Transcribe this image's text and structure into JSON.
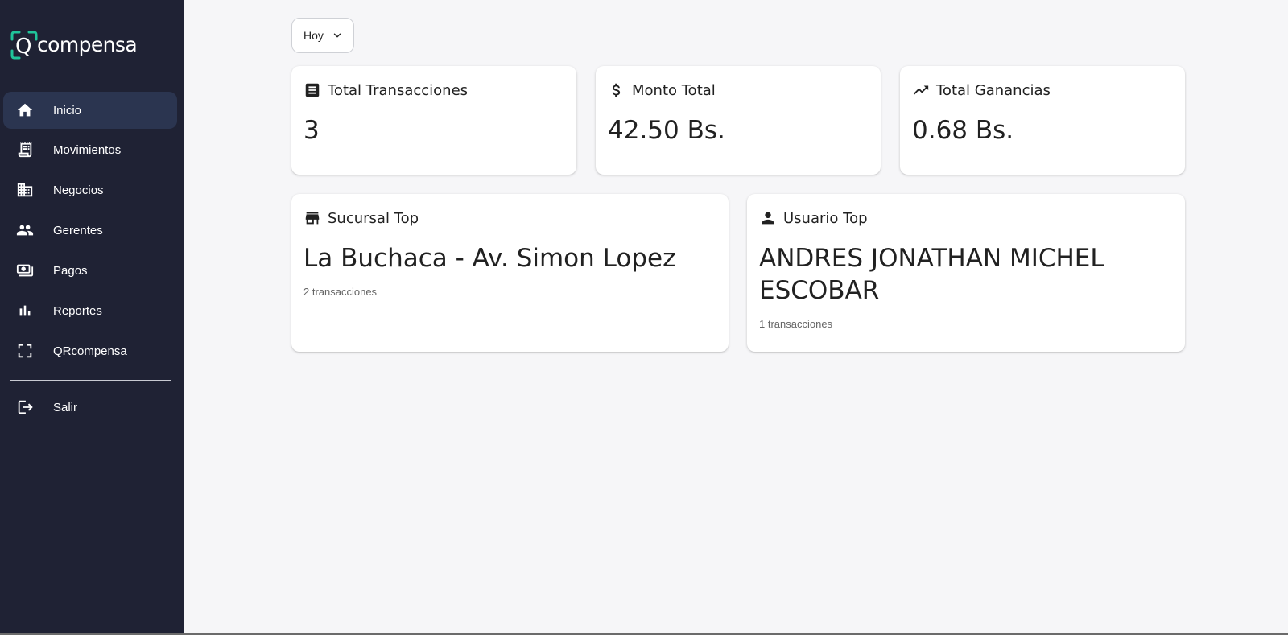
{
  "brand": {
    "name": "compensa",
    "accent_color": "#20c49a"
  },
  "sidebar": {
    "items": [
      {
        "label": "Inicio",
        "icon": "home-icon",
        "active": true
      },
      {
        "label": "Movimientos",
        "icon": "receipt-icon"
      },
      {
        "label": "Negocios",
        "icon": "business-icon"
      },
      {
        "label": "Gerentes",
        "icon": "people-icon"
      },
      {
        "label": "Pagos",
        "icon": "payments-icon"
      },
      {
        "label": "Reportes",
        "icon": "bar-chart-icon"
      },
      {
        "label": "QRcompensa",
        "icon": "scan-frame-icon"
      }
    ],
    "logout": {
      "label": "Salir",
      "icon": "logout-icon"
    }
  },
  "filter": {
    "period": "Hoy"
  },
  "stats": [
    {
      "title": "Total Transacciones",
      "value": "3",
      "icon": "receipt-long-icon"
    },
    {
      "title": "Monto Total",
      "value": "42.50 Bs.",
      "icon": "dollar-icon"
    },
    {
      "title": "Total Ganancias",
      "value": "0.68 Bs.",
      "icon": "trending-up-icon"
    }
  ],
  "top_branch": {
    "title": "Sucursal Top",
    "name": "La Buchaca - Av. Simon Lopez",
    "count": "2 transacciones",
    "icon": "store-icon"
  },
  "top_user": {
    "title": "Usuario Top",
    "name": "ANDRES JONATHAN MICHEL ESCOBAR",
    "count": "1 transacciones",
    "icon": "person-icon"
  }
}
